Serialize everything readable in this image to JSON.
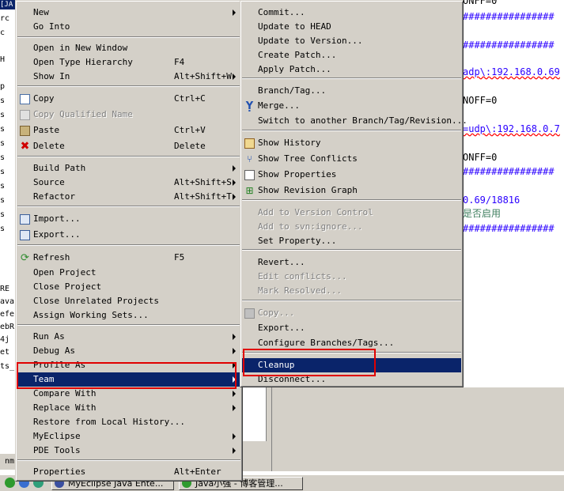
{
  "background": {
    "left_tab": "[JA",
    "left_labels": [
      "rc",
      "c",
      "",
      "H",
      "",
      "p",
      "s",
      "s",
      "s",
      "s",
      "s",
      "s",
      "s",
      "s",
      "s",
      "s",
      "RE",
      "ava",
      "efe",
      "ebR",
      "4j",
      "et",
      "ts_"
    ],
    "status_text": "nm",
    "editor_lines": [
      {
        "text": "ONFF=0",
        "class": "c-black"
      },
      {
        "text": "################",
        "class": "c-blue"
      },
      {
        "text": "################",
        "class": "c-blue"
      },
      {
        "text": "adp\\:192.168.0.69",
        "class": "c-blue"
      },
      {
        "text": "NOFF=0",
        "class": "c-black"
      },
      {
        "text": "=udp\\:192.168.0.7",
        "class": "c-blue"
      },
      {
        "text": "ONFF=0",
        "class": "c-black"
      },
      {
        "text": "################",
        "class": "c-blue"
      },
      {
        "text": "0.69/18816",
        "class": "c-blue"
      },
      {
        "text": "是否启用",
        "class": "c-green"
      },
      {
        "text": "################",
        "class": "c-blue"
      }
    ]
  },
  "taskbar": {
    "items": [
      {
        "label": "MyEclipse Java Ente..."
      },
      {
        "label": "Java小强 - 博客管理..."
      }
    ]
  },
  "context_menu": {
    "items": [
      {
        "label": "New",
        "accel": "",
        "submenu": true
      },
      {
        "label": "Go Into",
        "accel": ""
      },
      {
        "label": "Open in New Window",
        "accel": ""
      },
      {
        "label": "Open Type Hierarchy",
        "accel": "F4"
      },
      {
        "label": "Show In",
        "accel": "Alt+Shift+W",
        "submenu": true
      },
      {
        "label": "Copy",
        "accel": "Ctrl+C",
        "icon": "copy-icon"
      },
      {
        "label": "Copy Qualified Name",
        "accel": "",
        "icon": "copy-qualified-icon",
        "disabled": true
      },
      {
        "label": "Paste",
        "accel": "Ctrl+V",
        "icon": "paste-icon"
      },
      {
        "label": "Delete",
        "accel": "Delete",
        "icon": "delete-icon"
      },
      {
        "label": "Build Path",
        "accel": "",
        "submenu": true
      },
      {
        "label": "Source",
        "accel": "Alt+Shift+S",
        "submenu": true
      },
      {
        "label": "Refactor",
        "accel": "Alt+Shift+T",
        "submenu": true
      },
      {
        "label": "Import...",
        "accel": "",
        "icon": "import-icon"
      },
      {
        "label": "Export...",
        "accel": "",
        "icon": "export-icon"
      },
      {
        "label": "Refresh",
        "accel": "F5",
        "icon": "refresh-icon"
      },
      {
        "label": "Open Project",
        "accel": ""
      },
      {
        "label": "Close Project",
        "accel": ""
      },
      {
        "label": "Close Unrelated Projects",
        "accel": ""
      },
      {
        "label": "Assign Working Sets...",
        "accel": ""
      },
      {
        "label": "Run As",
        "accel": "",
        "submenu": true
      },
      {
        "label": "Debug As",
        "accel": "",
        "submenu": true
      },
      {
        "label": "Profile As",
        "accel": "",
        "submenu": true
      },
      {
        "label": "Team",
        "accel": "",
        "submenu": true,
        "selected": true
      },
      {
        "label": "Compare With",
        "accel": "",
        "submenu": true
      },
      {
        "label": "Replace With",
        "accel": "",
        "submenu": true
      },
      {
        "label": "Restore from Local History...",
        "accel": ""
      },
      {
        "label": "MyEclipse",
        "accel": "",
        "submenu": true
      },
      {
        "label": "PDE Tools",
        "accel": "",
        "submenu": true
      },
      {
        "label": "Properties",
        "accel": "Alt+Enter"
      }
    ]
  },
  "team_menu": {
    "items": [
      {
        "label": "Commit..."
      },
      {
        "label": "Update to HEAD"
      },
      {
        "label": "Update to Version..."
      },
      {
        "label": "Create Patch..."
      },
      {
        "label": "Apply Patch..."
      },
      {
        "label": "Branch/Tag..."
      },
      {
        "label": "Merge...",
        "icon": "merge-icon"
      },
      {
        "label": "Switch to another Branch/Tag/Revision..."
      },
      {
        "label": "Show History",
        "icon": "history-icon"
      },
      {
        "label": "Show Tree Conflicts",
        "icon": "tree-conflicts-icon"
      },
      {
        "label": "Show Properties",
        "icon": "properties-icon"
      },
      {
        "label": "Show Revision Graph",
        "icon": "revision-graph-icon"
      },
      {
        "label": "Add to Version Control",
        "disabled": true
      },
      {
        "label": "Add to svn:ignore...",
        "disabled": true
      },
      {
        "label": "Set Property..."
      },
      {
        "label": "Revert..."
      },
      {
        "label": "Edit conflicts...",
        "disabled": true
      },
      {
        "label": "Mark Resolved...",
        "disabled": true
      },
      {
        "label": "Copy...",
        "disabled": true,
        "icon": "copy-svn-icon"
      },
      {
        "label": "Export..."
      },
      {
        "label": "Configure Branches/Tags..."
      },
      {
        "label": "Cleanup",
        "selected": true
      },
      {
        "label": "Disconnect..."
      }
    ]
  }
}
